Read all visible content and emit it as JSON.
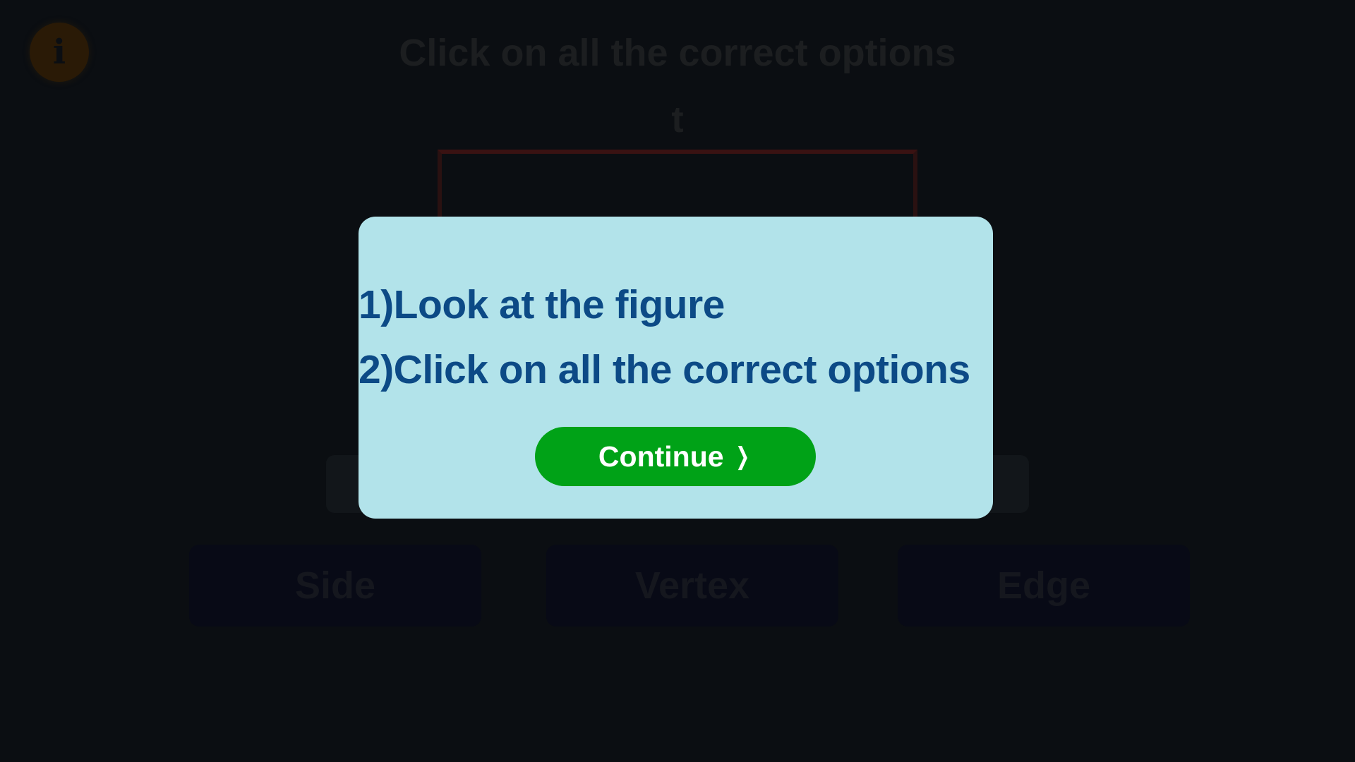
{
  "background": {
    "info_icon_glyph": "i",
    "title": "Click on all the correct options",
    "figure_label": "t",
    "options": [
      {
        "label": "Side"
      },
      {
        "label": "Vertex"
      },
      {
        "label": "Edge"
      }
    ]
  },
  "modal": {
    "instructions": [
      "1)Look at the figure",
      "2)Click on all the correct options"
    ],
    "continue_label": "Continue",
    "continue_icon": "chevron-right-icon"
  },
  "colors": {
    "modal_bg": "#b2e3ea",
    "instruction_text": "#0c4a86",
    "continue_button": "#00a217",
    "overlay": "#0b0e12"
  }
}
